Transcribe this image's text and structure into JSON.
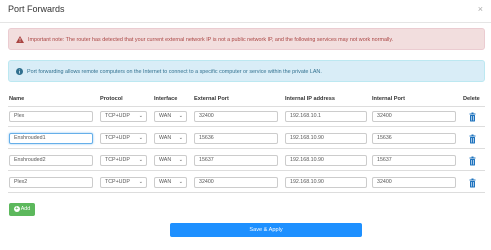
{
  "modal": {
    "title": "Port Forwards",
    "close_symbol": "×"
  },
  "alerts": {
    "warning": {
      "icon": "warning-triangle-icon",
      "text": "Important note: The router has detected that your current external network IP is not a public network IP, and the following services may not work normally.",
      "color": "#a94442"
    },
    "info": {
      "icon": "info-circle-icon",
      "text": "Port forwarding allows remote computers on the Internet to connect to a specific computer or service within the private LAN.",
      "color": "#31708f"
    }
  },
  "table": {
    "headers": [
      "Name",
      "Protocol",
      "Interface",
      "External Port",
      "Internal IP address",
      "Internal Port",
      "Delete"
    ],
    "rows": [
      {
        "name": "Plex",
        "protocol": "TCP+UDP",
        "interface": "WAN",
        "external_port": "32400",
        "internal_ip": "192.168.10.1",
        "internal_port": "32400"
      },
      {
        "name": "Enshrouded1",
        "protocol": "TCP+UDP",
        "interface": "WAN",
        "external_port": "15636",
        "internal_ip": "192.168.10.90",
        "internal_port": "15636"
      },
      {
        "name": "Enshrouded2",
        "protocol": "TCP+UDP",
        "interface": "WAN",
        "external_port": "15637",
        "internal_ip": "192.168.10.90",
        "internal_port": "15637"
      },
      {
        "name": "Plex2",
        "protocol": "TCP+UDP",
        "interface": "WAN",
        "external_port": "32400",
        "internal_ip": "192.168.10.90",
        "internal_port": "32400"
      }
    ]
  },
  "buttons": {
    "add_label": "Add",
    "add_color": "#5cb85c",
    "save_label": "Save & Apply",
    "save_color": "#1e90ff"
  },
  "icons": {
    "delete": "trash-icon",
    "select_caret": "chevron-down-icon"
  },
  "colors": {
    "trash": "#1e73be"
  }
}
